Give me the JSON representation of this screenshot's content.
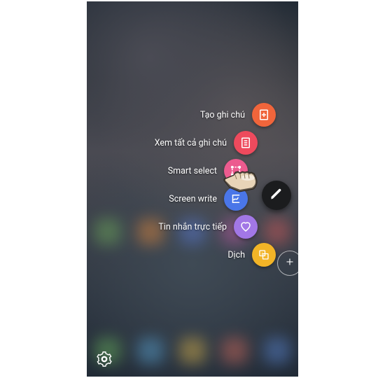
{
  "menu": {
    "items": [
      {
        "label": "Tạo ghi chú",
        "icon": "note-add-icon",
        "color": "#f0653b"
      },
      {
        "label": "Xem tất cả ghi chú",
        "icon": "notes-list-icon",
        "color": "#ee4a5d"
      },
      {
        "label": "Smart select",
        "icon": "smart-select-icon",
        "color": "#ec5b8f"
      },
      {
        "label": "Screen write",
        "icon": "screen-write-icon",
        "color": "#4a76e8"
      },
      {
        "label": "Tin nhắn trực tiếp",
        "icon": "heart-icon",
        "color": "#a277e6"
      },
      {
        "label": "Dịch",
        "icon": "translate-icon",
        "color": "#f2b427"
      }
    ]
  },
  "buttons": {
    "pen": "pen",
    "add": "add",
    "settings": "settings"
  }
}
